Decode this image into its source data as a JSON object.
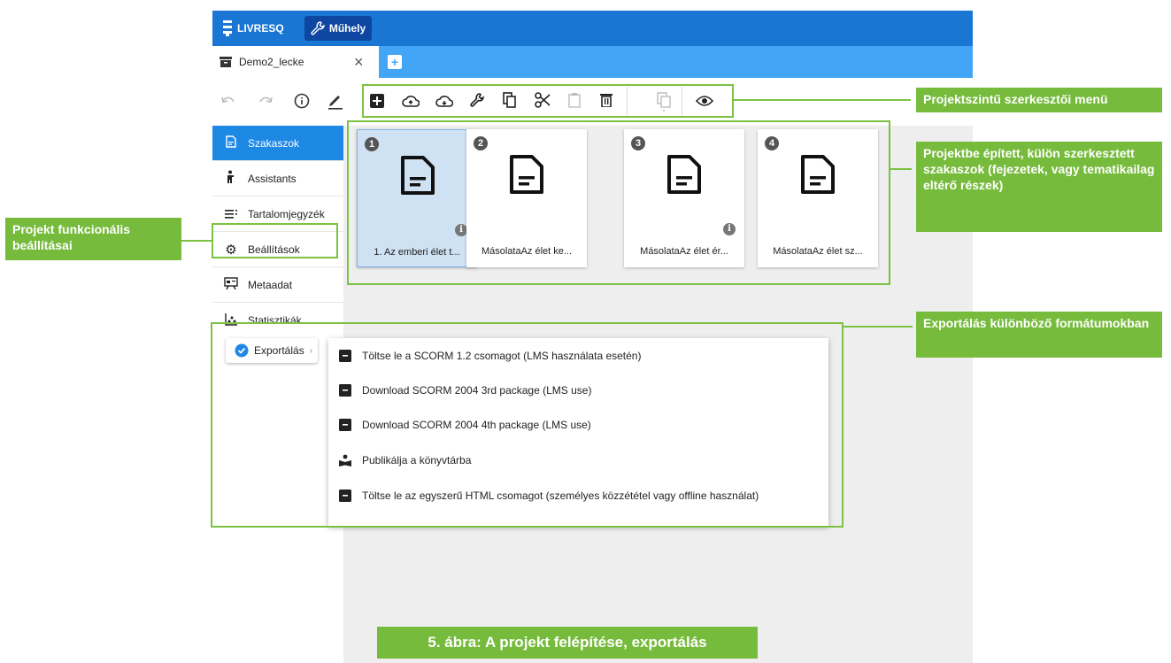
{
  "app": {
    "logo_text": "LIVRESQ",
    "workshop_label": "Műhely",
    "tab_title": "Demo2_lecke",
    "accent_color": "#1976d2"
  },
  "toolbar": {
    "icons": [
      "undo-icon",
      "redo-icon",
      "info-icon",
      "edit-icon",
      "add-icon",
      "cloud-upload-icon",
      "cloud-download-icon",
      "wrench-icon",
      "copy-icon",
      "cut-icon",
      "paste-icon",
      "delete-icon",
      "duplicate-icon",
      "preview-icon"
    ]
  },
  "sidebar": {
    "items": [
      {
        "label": "Szakaszok",
        "icon": "document-icon"
      },
      {
        "label": "Assistants",
        "icon": "person-icon"
      },
      {
        "label": "Tartalomjegyzék",
        "icon": "list-icon"
      },
      {
        "label": "Beállítások",
        "icon": "gear-icon"
      },
      {
        "label": "Metaadat",
        "icon": "metadata-icon"
      },
      {
        "label": "Statisztikák",
        "icon": "stats-icon"
      }
    ]
  },
  "sections": [
    {
      "number": "1",
      "label": "1. Az emberi élet t...",
      "selected": true,
      "info": true
    },
    {
      "number": "2",
      "label": "MásolataAz élet ke...",
      "selected": false,
      "info": false
    },
    {
      "number": "3",
      "label": "MásolataAz élet ér...",
      "selected": false,
      "info": true
    },
    {
      "number": "4",
      "label": "MásolataAz élet sz...",
      "selected": false,
      "info": false
    }
  ],
  "export": {
    "button_label": "Exportálás",
    "menu": [
      "Töltse le a SCORM 1.2 csomagot (LMS használata esetén)",
      "Download SCORM 2004 3rd package (LMS use)",
      "Download SCORM 2004 4th package (LMS use)",
      "Publikálja a könyvtárba",
      "Töltse le az egyszerű HTML csomagot (személyes közzététel vagy offline használat)"
    ]
  },
  "annotations": {
    "toolbar": "Projektszintű szerkesztői menü",
    "sections": "Projektbe épített, külön szerkesztett szakaszok (fejezetek, vagy tematikailag eltérő részek)",
    "settings": "Projekt funkcionális beállításai",
    "export": "Exportálás különböző formátumokban",
    "color": "#76bb3c"
  },
  "caption": "5. ábra: A projekt felépítése, exportálás"
}
